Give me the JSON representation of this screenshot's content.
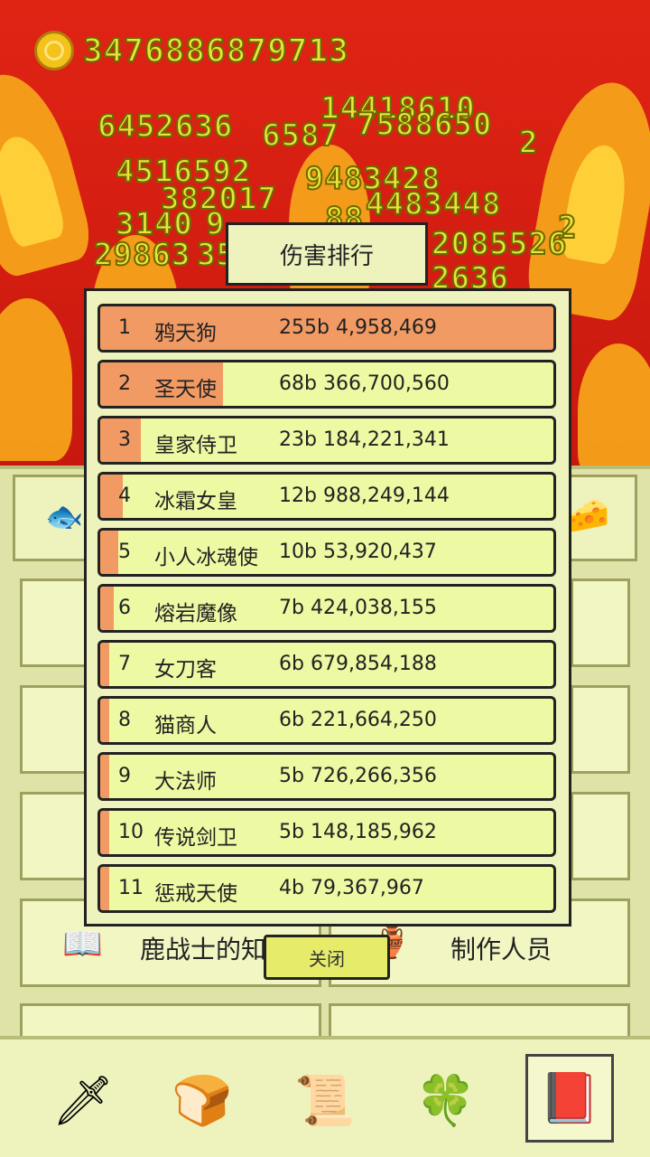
{
  "currency": {
    "coins": "3476886879713",
    "coin_icon": "gold-coin-icon"
  },
  "damage_popups": [
    "6452636",
    "14418610",
    "6587",
    "7588650",
    "2",
    "4516592",
    "9483428",
    "382017",
    "4483448",
    "3140",
    "9",
    "2",
    "88",
    "2085526",
    "29863",
    "35",
    "2636"
  ],
  "modal": {
    "title": "伤害排行",
    "close_label": "关闭",
    "rows": [
      {
        "rank": "1",
        "name": "鸦天狗",
        "value": "255b 4,958,469",
        "fill": 1.0
      },
      {
        "rank": "2",
        "name": "圣天使",
        "value": "68b 366,700,560",
        "fill": 0.27
      },
      {
        "rank": "3",
        "name": "皇家侍卫",
        "value": "23b 184,221,341",
        "fill": 0.09
      },
      {
        "rank": "4",
        "name": "冰霜女皇",
        "value": "12b 988,249,144",
        "fill": 0.05
      },
      {
        "rank": "5",
        "name": "小人冰魂使",
        "value": "10b 53,920,437",
        "fill": 0.04
      },
      {
        "rank": "6",
        "name": "熔岩魔像",
        "value": "7b 424,038,155",
        "fill": 0.03
      },
      {
        "rank": "7",
        "name": "女刀客",
        "value": "6b 679,854,188",
        "fill": 0.02
      },
      {
        "rank": "8",
        "name": "猫商人",
        "value": "6b 221,664,250",
        "fill": 0.02
      },
      {
        "rank": "9",
        "name": "大法师",
        "value": "5b 726,266,356",
        "fill": 0.02
      },
      {
        "rank": "10",
        "name": "传说剑卫",
        "value": "5b 148,185,962",
        "fill": 0.02
      },
      {
        "rank": "11",
        "name": "惩戒天使",
        "value": "4b 79,367,967",
        "fill": 0.02
      }
    ]
  },
  "menu": {
    "book_label": "鹿战士的知识",
    "credits_label": "制作人员"
  },
  "bottom_nav": [
    {
      "name": "sword-icon"
    },
    {
      "name": "bread-icon"
    },
    {
      "name": "scroll-icon"
    },
    {
      "name": "clover-icon"
    },
    {
      "name": "book-icon",
      "active": true
    }
  ],
  "colors": {
    "fill": "#f29a64",
    "row_bg": "#eef9a3",
    "panel": "#eef3bd",
    "fire": "#e02414"
  }
}
